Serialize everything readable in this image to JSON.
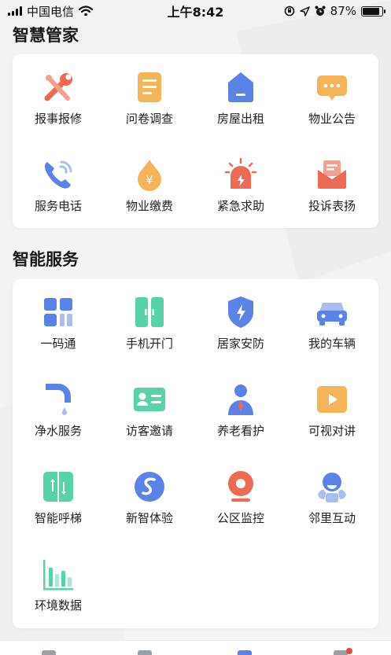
{
  "status_bar": {
    "carrier": "中国电信",
    "time": "上午8:42",
    "battery": "87%",
    "battery_level": 0.87
  },
  "sections": {
    "smart_butler": {
      "title": "智慧管家",
      "items": [
        {
          "label": "报事报修",
          "icon": "repair-tools-icon"
        },
        {
          "label": "问卷调查",
          "icon": "survey-document-icon"
        },
        {
          "label": "房屋出租",
          "icon": "house-rent-icon"
        },
        {
          "label": "物业公告",
          "icon": "announcement-bubble-icon"
        },
        {
          "label": "服务电话",
          "icon": "phone-icon"
        },
        {
          "label": "物业缴费",
          "icon": "yuan-payment-icon"
        },
        {
          "label": "紧急求助",
          "icon": "emergency-siren-icon"
        },
        {
          "label": "投诉表扬",
          "icon": "complaint-envelope-icon"
        }
      ]
    },
    "smart_services": {
      "title": "智能服务",
      "items": [
        {
          "label": "一码通",
          "icon": "qr-code-icon"
        },
        {
          "label": "手机开门",
          "icon": "door-open-icon"
        },
        {
          "label": "居家安防",
          "icon": "security-shield-icon"
        },
        {
          "label": "我的车辆",
          "icon": "car-icon"
        },
        {
          "label": "净水服务",
          "icon": "water-faucet-icon"
        },
        {
          "label": "访客邀请",
          "icon": "visitor-card-icon"
        },
        {
          "label": "养老看护",
          "icon": "elderly-care-icon"
        },
        {
          "label": "可视对讲",
          "icon": "video-intercom-icon"
        },
        {
          "label": "智能呼梯",
          "icon": "elevator-icon"
        },
        {
          "label": "新智体验",
          "icon": "new-experience-icon"
        },
        {
          "label": "公区监控",
          "icon": "camera-monitor-icon"
        },
        {
          "label": "邻里互动",
          "icon": "neighbor-interaction-icon"
        },
        {
          "label": "环境数据",
          "icon": "environment-chart-icon"
        }
      ]
    }
  },
  "colors": {
    "red": "#ef6a55",
    "orange": "#f3b45a",
    "blue": "#5b82e6",
    "green": "#58d3a8",
    "card": "#ffffff",
    "background": "#f2f3f5"
  }
}
